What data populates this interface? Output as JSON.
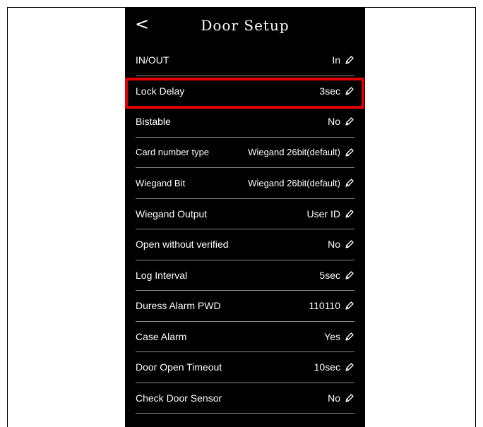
{
  "header": {
    "back_glyph": "<",
    "title": "Door Setup"
  },
  "rows": [
    {
      "label": "IN/OUT",
      "value": "In"
    },
    {
      "label": "Lock Delay",
      "value": "3sec"
    },
    {
      "label": "Bistable",
      "value": "No"
    },
    {
      "label": "Card number type",
      "value": "Wiegand 26bit(default)"
    },
    {
      "label": "Wiegand Bit",
      "value": "Wiegand 26bit(default)"
    },
    {
      "label": "Wiegand Output",
      "value": "User ID"
    },
    {
      "label": "Open without verified",
      "value": "No"
    },
    {
      "label": "Log Interval",
      "value": "5sec"
    },
    {
      "label": "Duress Alarm PWD",
      "value": "110110"
    },
    {
      "label": "Case Alarm",
      "value": "Yes"
    },
    {
      "label": "Door Open Timeout",
      "value": "10sec"
    },
    {
      "label": "Check Door Sensor",
      "value": "No"
    }
  ],
  "colors": {
    "background": "#000000",
    "text": "#ffffff",
    "divider": "#8a8a8a",
    "highlight": "#e50000"
  },
  "icons": {
    "edit": "pencil-icon",
    "back": "chevron-left-icon"
  }
}
